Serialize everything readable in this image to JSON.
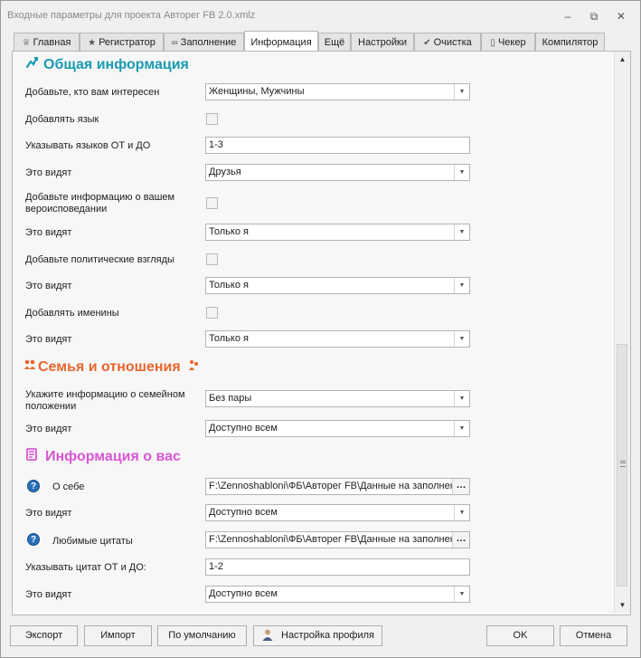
{
  "window": {
    "title": "Входные параметры для проекта Авторег FB 2.0.xmlz"
  },
  "controls": {
    "minimize": "‒",
    "restore": "⧉",
    "close": "✕"
  },
  "tabs": [
    {
      "label": "Главная",
      "icon": "♕"
    },
    {
      "label": "Регистратор",
      "icon": "★"
    },
    {
      "label": "Заполнение",
      "icon": "∞"
    },
    {
      "label": "Информация",
      "icon": ""
    },
    {
      "label": "Ещё",
      "icon": ""
    },
    {
      "label": "Настройки",
      "icon": ""
    },
    {
      "label": "Очистка",
      "icon": "✔"
    },
    {
      "label": "Чекер",
      "icon": "▯"
    },
    {
      "label": "Компилятор",
      "icon": ""
    }
  ],
  "active_tab": "Информация",
  "sections": {
    "general": {
      "title": "Общая информация",
      "icon": "arrow-icon",
      "color": "#1a9bb0"
    },
    "family": {
      "title": "Семья и отношения",
      "icon": "people-icon",
      "color": "#e8662e"
    },
    "about": {
      "title": "Информация о вас",
      "icon": "book-icon",
      "color": "#d957d4"
    }
  },
  "fields": {
    "interested": {
      "label": "Добавьте, кто вам интересен",
      "value": "Женщины, Мужчины"
    },
    "add_language": {
      "label": "Добавлять язык",
      "checked": false
    },
    "lang_range": {
      "label": "Указывать языков ОТ и ДО",
      "value": "1-3"
    },
    "lang_visibility": {
      "label": "Это видят",
      "value": "Друзья"
    },
    "religion": {
      "label": "Добавьте информацию о вашем вероисповедании",
      "checked": false
    },
    "religion_visibility": {
      "label": "Это видят",
      "value": "Только я"
    },
    "politics": {
      "label": "Добавьте политические взгляды",
      "checked": false
    },
    "politics_visibility": {
      "label": "Это видят",
      "value": "Только я"
    },
    "nameday": {
      "label": "Добавлять именины",
      "checked": false
    },
    "nameday_visibility": {
      "label": "Это видят",
      "value": "Только я"
    },
    "relationship": {
      "label": "Укажите информацию о семейном положении",
      "value": "Без пары"
    },
    "relationship_visibility": {
      "label": "Это видят",
      "value": "Доступно всем"
    },
    "about_me": {
      "label": "О себе",
      "value": "F:\\Zennoshabloni\\ФБ\\Авторег FB\\Данные на заполнен"
    },
    "about_me_visibility": {
      "label": "Это видят",
      "value": "Доступно всем"
    },
    "quotes": {
      "label": "Любимые цитаты",
      "value": "F:\\Zennoshabloni\\ФБ\\Авторег FB\\Данные на заполнен"
    },
    "quotes_range": {
      "label": "Указывать цитат ОТ и ДО:",
      "value": "1-2"
    },
    "quotes_visibility": {
      "label": "Это видят",
      "value": "Доступно всем"
    }
  },
  "buttons": {
    "export": "Экспорт",
    "import": "Импорт",
    "defaults": "По умолчанию",
    "profile": "Настройка профиля",
    "ok": "OK",
    "cancel": "Отмена"
  }
}
